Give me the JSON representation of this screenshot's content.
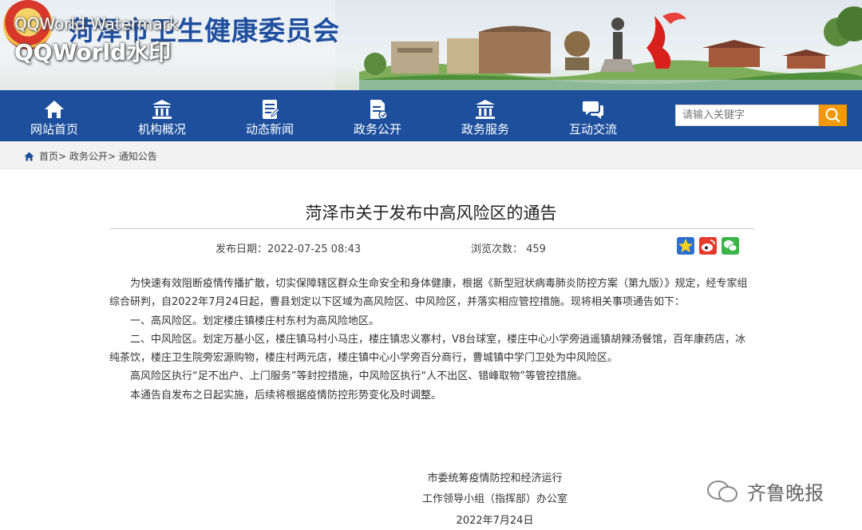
{
  "header": {
    "site_title": "菏泽市卫生健康委员会",
    "watermark_line1": "QQWorld Watermark",
    "watermark_line2": "QQWorld水印"
  },
  "nav": {
    "items": [
      {
        "label": "网站首页",
        "icon": "home-icon"
      },
      {
        "label": "机构概况",
        "icon": "institution-icon"
      },
      {
        "label": "动态新闻",
        "icon": "news-icon"
      },
      {
        "label": "政务公开",
        "icon": "document-icon"
      },
      {
        "label": "政务服务",
        "icon": "service-icon"
      },
      {
        "label": "互动交流",
        "icon": "chat-icon"
      }
    ],
    "search_placeholder": "请输入关键字"
  },
  "breadcrumb": {
    "text": "首页> 政务公开> 通知公告"
  },
  "article": {
    "title": "菏泽市关于发布中高风险区的通告",
    "publish_date": "发布日期：2022-07-25 08:43",
    "views": "浏览次数：  459",
    "paragraphs": [
      "为快速有效阻断疫情传播扩散，切实保障辖区群众生命安全和身体健康，根据《新型冠状病毒肺炎防控方案（第九版）》规定，经专家组综合研判，自2022年7月24日起，曹县划定以下区域为高风险区、中风险区，并落实相应管控措施。现将相关事项通告如下：",
      "一、高风险区。划定楼庄镇楼庄村东村为高风险地区。",
      "二、中风险区。划定万基小区，楼庄镇马村小马庄，楼庄镇忠义寨村，V8台球室，楼庄中心小学旁逍遥镇胡辣汤餐馆，百年康药店，冰纯茶饮，楼庄卫生院旁宏源购物，楼庄村两元店，楼庄镇中心小学旁百分商行，曹城镇中学门卫处为中风险区。",
      "高风险区执行“足不出户、上门服务”等封控措施，中风险区执行“人不出区、错峰取物”等管控措施。",
      "本通告自发布之日起实施，后续将根据疫情防控形势变化及时调整。"
    ],
    "signature": [
      "市委统筹疫情防控和经济运行",
      "工作领导小组（指挥部）办公室",
      "2022年7月24日"
    ]
  },
  "brand_watermark": "齐鲁晚报",
  "colors": {
    "nav_bg": "#1e4f9c",
    "title_blue": "#1f4fa0",
    "search_button": "#f39800",
    "crumb_bg": "#f2f2f2"
  }
}
